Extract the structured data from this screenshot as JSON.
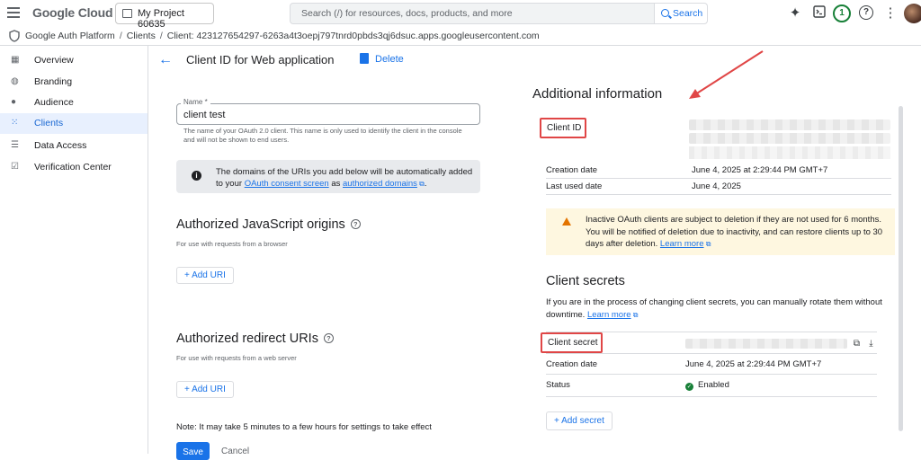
{
  "topbar": {
    "brand": "Google Cloud",
    "project": "My Project 60635",
    "search_placeholder": "Search (/) for resources, docs, products, and more",
    "search_button": "Search",
    "notification_count": "1"
  },
  "breadcrumb": {
    "items": [
      "Google Auth Platform",
      "Clients",
      "Client: 423127654297-6263a4t3oepj797tnrd0pbds3qj6dsuc.apps.googleusercontent.com"
    ]
  },
  "sidebar": {
    "items": [
      {
        "label": "Overview",
        "icon": "dashboard-icon"
      },
      {
        "label": "Branding",
        "icon": "palette-icon"
      },
      {
        "label": "Audience",
        "icon": "person-icon"
      },
      {
        "label": "Clients",
        "icon": "grid-icon",
        "active": true
      },
      {
        "label": "Data Access",
        "icon": "list-lock-icon"
      },
      {
        "label": "Verification Center",
        "icon": "checklist-icon"
      }
    ]
  },
  "header": {
    "title": "Client ID for Web application",
    "delete_label": "Delete"
  },
  "form": {
    "name_label": "Name *",
    "name_value": "client test",
    "name_help": "The name of your OAuth 2.0 client. This name is only used to identify the client in the console and will not be shown to end users.",
    "info_text_1": "The domains of the URIs you add below will be automatically added to your ",
    "info_link_1": "OAuth consent screen",
    "info_text_2": " as ",
    "info_link_2": "authorized domains",
    "info_text_3": ".",
    "js_origins_title": "Authorized JavaScript origins",
    "js_origins_desc": "For use with requests from a browser",
    "add_uri_label": "+ Add URI",
    "redirect_title": "Authorized redirect URIs",
    "redirect_desc": "For use with requests from a web server",
    "note": "Note: It may take 5 minutes to a few hours for settings to take effect",
    "save_label": "Save",
    "cancel_label": "Cancel"
  },
  "additional": {
    "title": "Additional information",
    "client_id_label": "Client ID",
    "creation_date_label": "Creation date",
    "creation_date_value": "June 4, 2025 at 2:29:44 PM GMT+7",
    "last_used_label": "Last used date",
    "last_used_value": "June 4, 2025",
    "warning_text": "Inactive OAuth clients are subject to deletion if they are not used for 6 months. You will be notified of deletion due to inactivity, and can restore clients up to 30 days after deletion. ",
    "warning_link": "Learn more"
  },
  "secrets": {
    "title": "Client secrets",
    "desc": "If you are in the process of changing client secrets, you can manually rotate them without downtime. ",
    "desc_link": "Learn more",
    "secret_label": "Client secret",
    "creation_date_label": "Creation date",
    "creation_date_value": "June 4, 2025 at 2:29:44 PM GMT+7",
    "status_label": "Status",
    "status_value": "Enabled",
    "add_secret_label": "+ Add secret"
  },
  "colors": {
    "accent": "#1a73e8",
    "annotation_red": "#e04646",
    "active_bg": "#e8f0fe",
    "warning_bg": "#fef7e0"
  }
}
